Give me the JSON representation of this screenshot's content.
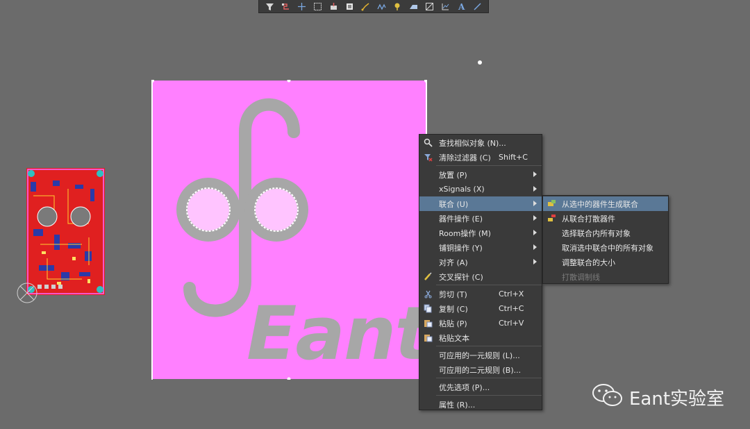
{
  "toolbar": {
    "buttons": [
      {
        "name": "filter-icon"
      },
      {
        "name": "route-icon"
      },
      {
        "name": "cross-icon"
      },
      {
        "name": "rectangle-select-icon"
      },
      {
        "name": "place-component-icon"
      },
      {
        "name": "pad-icon"
      },
      {
        "name": "interactive-route-icon"
      },
      {
        "name": "diff-pair-icon"
      },
      {
        "name": "via-icon"
      },
      {
        "name": "polygon-icon"
      },
      {
        "name": "fill-icon"
      },
      {
        "name": "dimension-icon"
      },
      {
        "name": "text-icon"
      },
      {
        "name": "line-icon"
      }
    ]
  },
  "board": {
    "logo_text": "Eant",
    "fill_color": "#ff80ff",
    "logo_color": "#a7a7a7"
  },
  "context_menu": {
    "items": [
      {
        "label": "查找相似对象 (N)...",
        "shortcut": "",
        "icon": "find-similar-icon"
      },
      {
        "label": "清除过滤器 (C)",
        "shortcut": "Shift+C",
        "icon": "clear-filter-icon"
      },
      {
        "label": "放置 (P)",
        "shortcut": "",
        "submenu": true
      },
      {
        "label": "xSignals (X)",
        "shortcut": "",
        "submenu": true
      },
      {
        "label": "联合 (U)",
        "shortcut": "",
        "submenu": true,
        "highlighted": true
      },
      {
        "label": "器件操作 (E)",
        "shortcut": "",
        "submenu": true
      },
      {
        "label": "Room操作 (M)",
        "shortcut": "",
        "submenu": true
      },
      {
        "label": "铺铜操作 (Y)",
        "shortcut": "",
        "submenu": true
      },
      {
        "label": "对齐 (A)",
        "shortcut": "",
        "submenu": true
      },
      {
        "label": "交叉探针 (C)",
        "shortcut": "",
        "icon": "cross-probe-icon"
      },
      {
        "label": "剪切 (T)",
        "shortcut": "Ctrl+X",
        "icon": "cut-icon"
      },
      {
        "label": "复制 (C)",
        "shortcut": "Ctrl+C",
        "icon": "copy-icon"
      },
      {
        "label": "粘贴 (P)",
        "shortcut": "Ctrl+V",
        "icon": "paste-icon"
      },
      {
        "label": "粘贴文本",
        "shortcut": "",
        "icon": "paste-text-icon"
      },
      {
        "label": "可应用的一元规则 (L)...",
        "shortcut": ""
      },
      {
        "label": "可应用的二元规则 (B)...",
        "shortcut": ""
      },
      {
        "label": "优先选项 (P)...",
        "shortcut": ""
      },
      {
        "label": "属性 (R)...",
        "shortcut": ""
      }
    ]
  },
  "union_submenu": {
    "items": [
      {
        "label": "从选中的器件生成联合",
        "highlighted": true,
        "icon": "create-union-icon"
      },
      {
        "label": "从联合打散器件",
        "icon": "break-union-icon"
      },
      {
        "label": "选择联合内所有对象"
      },
      {
        "label": "取消选中联合中的所有对象"
      },
      {
        "label": "调整联合的大小"
      },
      {
        "label": "打散调制线",
        "disabled": true
      }
    ]
  },
  "watermark": {
    "text": "Eant实验室"
  }
}
